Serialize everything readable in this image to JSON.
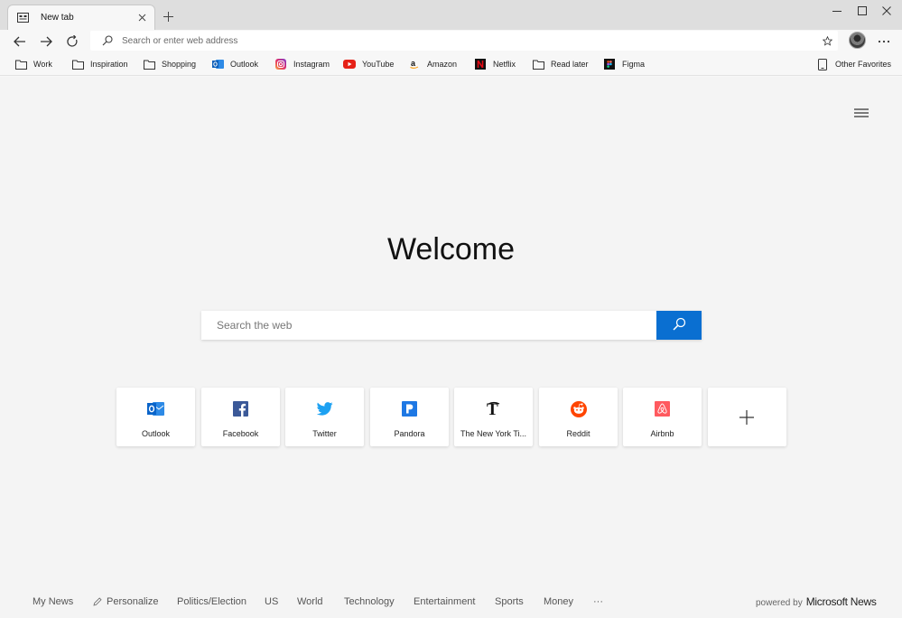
{
  "tab": {
    "title": "New tab"
  },
  "address": {
    "placeholder": "Search or enter web address"
  },
  "favorites": [
    {
      "label": "Work",
      "icon": "folder-icon"
    },
    {
      "label": "Inspiration",
      "icon": "folder-icon"
    },
    {
      "label": "Shopping",
      "icon": "folder-icon"
    },
    {
      "label": "Outlook",
      "icon": "outlook-icon"
    },
    {
      "label": "Instagram",
      "icon": "instagram-icon"
    },
    {
      "label": "YouTube",
      "icon": "youtube-icon"
    },
    {
      "label": "Amazon",
      "icon": "amazon-icon"
    },
    {
      "label": "Netflix",
      "icon": "netflix-icon"
    },
    {
      "label": "Read later",
      "icon": "folder-icon"
    },
    {
      "label": "Figma",
      "icon": "figma-icon"
    }
  ],
  "other_favorites": {
    "label": "Other Favorites"
  },
  "main": {
    "welcome": "Welcome",
    "search_placeholder": "Search the web"
  },
  "top_sites": [
    {
      "label": "Outlook",
      "icon": "outlook-icon",
      "color": "#0a64c9"
    },
    {
      "label": "Facebook",
      "icon": "facebook-icon",
      "color": "#3b5998"
    },
    {
      "label": "Twitter",
      "icon": "twitter-icon",
      "color": "#1da1f2"
    },
    {
      "label": "Pandora",
      "icon": "pandora-icon",
      "color": "#1e78e4"
    },
    {
      "label": "The New York Ti...",
      "icon": "nyt-icon",
      "color": "#111111"
    },
    {
      "label": "Reddit",
      "icon": "reddit-icon",
      "color": "#ff4500"
    },
    {
      "label": "Airbnb",
      "icon": "airbnb-icon",
      "color": "#ff5a5f"
    }
  ],
  "news": {
    "items": [
      "My News",
      "Personalize",
      "Politics/Election",
      "US",
      "World",
      "Technology",
      "Entertainment",
      "Sports",
      "Money"
    ],
    "more": "···",
    "powered_by": "powered by",
    "brand": "Microsoft News"
  },
  "colors": {
    "accent": "#0a6fd1",
    "chrome": "#dedede",
    "page": "#f4f4f4"
  }
}
